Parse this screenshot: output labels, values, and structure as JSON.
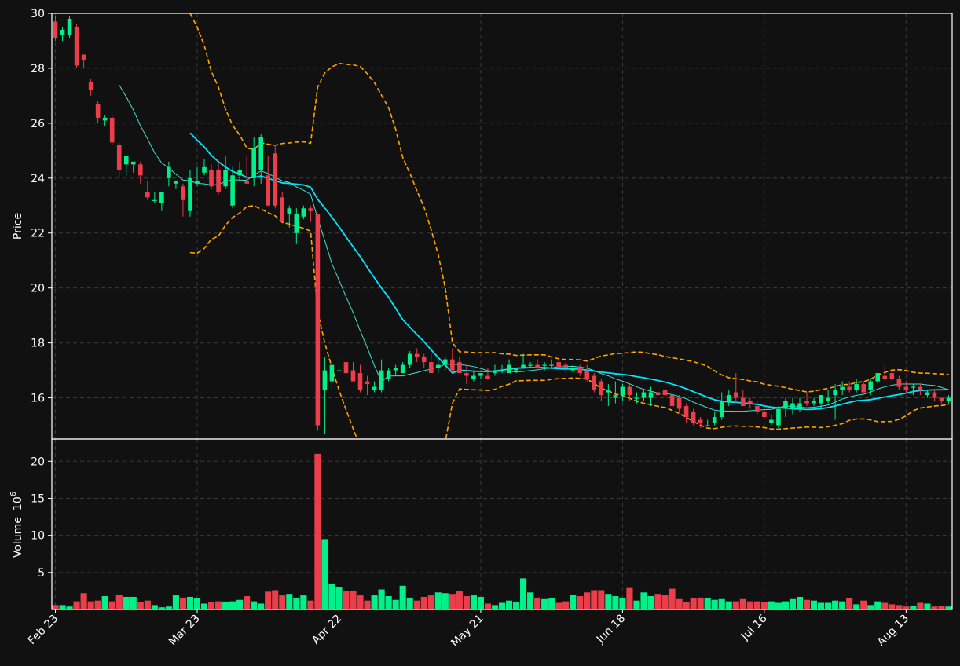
{
  "chart_data": {
    "type": "candlestick",
    "price_panel": {
      "ylabel": "Price",
      "ylim": [
        14.5,
        30
      ],
      "yticks": [
        16,
        18,
        20,
        22,
        24,
        26,
        28,
        30
      ],
      "grid": true
    },
    "volume_panel": {
      "ylabel": "Volume",
      "ylabel_exponent": "10",
      "ylabel_power": "6",
      "ylim": [
        0,
        23
      ],
      "yticks": [
        5,
        10,
        15,
        20
      ],
      "grid": true
    },
    "x_axis": {
      "n_bars": 127,
      "ticks": [
        {
          "label": "Feb 23",
          "index": 0
        },
        {
          "label": "Mar 23",
          "index": 20
        },
        {
          "label": "Apr 22",
          "index": 40
        },
        {
          "label": "May 21",
          "index": 60
        },
        {
          "label": "Jun 18",
          "index": 80
        },
        {
          "label": "Jul 16",
          "index": 100
        },
        {
          "label": "Aug 13",
          "index": 120
        }
      ]
    },
    "colors": {
      "background": "#111111",
      "up": "#00f08a",
      "down": "#ec3e4a",
      "ma_fast": "#40e0d0",
      "ma_slow": "#00e5ff",
      "bollinger": "#ffa500",
      "axis": "#ffffff",
      "grid": "#3a3a3a"
    },
    "moving_averages": [
      {
        "window": 10,
        "color": "#40e0d0",
        "line_width": 1
      },
      {
        "window": 20,
        "color": "#00e5ff",
        "line_width": 1.8
      }
    ],
    "bollinger": {
      "window": 20,
      "num_std": 2,
      "style": "dashed",
      "color": "#ffa500"
    },
    "candles": {
      "open": [
        29.7,
        29.2,
        29.2,
        29.5,
        28.5,
        27.5,
        26.7,
        26.1,
        26.2,
        25.2,
        24.5,
        24.5,
        24.5,
        23.5,
        23.2,
        23.1,
        24.0,
        23.8,
        23.7,
        22.8,
        23.8,
        24.2,
        24.3,
        24.3,
        23.7,
        23.0,
        24.1,
        23.9,
        24.0,
        24.3,
        24.1,
        24.9,
        23.3,
        22.7,
        22.0,
        22.6,
        22.9,
        22.7,
        16.3,
        16.6,
        17.0,
        17.3,
        17.0,
        16.9,
        16.6,
        16.3,
        16.3,
        16.7,
        17.0,
        16.9,
        17.2,
        17.6,
        17.5,
        17.3,
        17.1,
        17.2,
        17.4,
        17.3,
        16.9,
        16.7,
        16.8,
        16.8,
        16.9,
        17.0,
        16.9,
        17.0,
        17.1,
        17.2,
        17.2,
        17.2,
        17.2,
        17.3,
        17.2,
        17.0,
        17.1,
        17.0,
        16.8,
        16.6,
        16.2,
        16.0,
        16.1,
        16.4,
        16.0,
        16.0,
        16.0,
        16.2,
        16.3,
        16.1,
        16.0,
        15.7,
        15.5,
        15.2,
        15.0,
        15.1,
        15.3,
        15.9,
        16.2,
        16.0,
        15.9,
        15.7,
        15.5,
        15.1,
        15.0,
        15.6,
        15.6,
        15.6,
        15.9,
        15.8,
        15.8,
        15.9,
        16.1,
        16.3,
        16.4,
        16.3,
        16.5,
        16.3,
        16.6,
        16.8,
        16.9,
        16.7,
        16.4,
        16.4,
        16.4,
        16.1,
        16.2,
        16.0,
        15.9
      ],
      "high": [
        29.9,
        29.5,
        29.9,
        29.6,
        28.5,
        27.6,
        26.8,
        26.3,
        26.3,
        25.3,
        24.8,
        24.6,
        24.6,
        23.9,
        23.5,
        23.5,
        24.6,
        23.9,
        23.8,
        24.3,
        24.4,
        24.7,
        24.5,
        24.6,
        24.8,
        24.4,
        24.6,
        24.8,
        25.5,
        25.6,
        24.8,
        25.2,
        23.5,
        23.0,
        22.9,
        23.0,
        23.0,
        17.5,
        17.5,
        17.4,
        17.5,
        17.6,
        17.3,
        17.2,
        16.8,
        16.6,
        17.4,
        17.1,
        17.2,
        17.3,
        17.7,
        17.8,
        17.6,
        17.6,
        17.4,
        17.5,
        17.8,
        17.5,
        17.2,
        17.0,
        16.9,
        17.1,
        17.2,
        17.2,
        17.4,
        17.1,
        17.6,
        17.3,
        17.4,
        17.3,
        17.4,
        17.4,
        17.3,
        17.2,
        17.2,
        17.2,
        16.9,
        16.7,
        16.5,
        16.6,
        16.5,
        16.5,
        16.2,
        16.3,
        16.4,
        16.3,
        16.4,
        16.2,
        16.1,
        15.8,
        15.6,
        15.3,
        15.2,
        15.5,
        16.2,
        16.3,
        16.9,
        16.3,
        16.0,
        15.9,
        15.6,
        15.4,
        15.7,
        16.0,
        16.0,
        16.0,
        16.2,
        16.0,
        16.1,
        16.3,
        16.5,
        16.6,
        16.6,
        16.7,
        16.6,
        16.7,
        16.9,
        17.2,
        17.0,
        16.8,
        16.6,
        16.5,
        16.5,
        16.3,
        16.3,
        16.0,
        16.1
      ],
      "low": [
        29.0,
        29.0,
        29.1,
        28.0,
        28.0,
        27.0,
        26.0,
        25.9,
        25.2,
        24.0,
        24.1,
        24.2,
        23.8,
        23.2,
        23.1,
        22.8,
        23.7,
        23.6,
        22.6,
        22.6,
        23.7,
        24.1,
        23.6,
        23.4,
        23.6,
        22.9,
        23.9,
        23.8,
        23.7,
        23.8,
        23.6,
        22.9,
        22.7,
        22.2,
        21.6,
        22.5,
        22.4,
        14.8,
        14.7,
        16.3,
        16.9,
        16.8,
        16.8,
        16.2,
        16.1,
        16.2,
        16.2,
        16.6,
        16.8,
        16.9,
        17.1,
        17.3,
        17.1,
        17.0,
        16.9,
        17.0,
        17.3,
        16.9,
        16.5,
        16.6,
        16.7,
        16.7,
        16.8,
        16.9,
        16.9,
        16.9,
        17.1,
        17.1,
        17.0,
        17.0,
        17.1,
        17.1,
        16.9,
        16.9,
        16.8,
        16.6,
        16.2,
        15.9,
        15.7,
        15.8,
        15.9,
        15.9,
        15.8,
        15.9,
        15.7,
        16.1,
        16.0,
        15.8,
        15.5,
        15.1,
        15.0,
        14.9,
        15.0,
        15.0,
        15.2,
        15.7,
        15.8,
        15.7,
        15.6,
        15.4,
        15.3,
        15.0,
        14.9,
        15.3,
        15.4,
        15.5,
        15.7,
        15.7,
        15.6,
        15.8,
        15.2,
        16.1,
        16.2,
        16.2,
        16.2,
        16.1,
        16.5,
        16.6,
        16.6,
        16.3,
        16.2,
        16.1,
        16.1,
        16.0,
        15.9,
        15.8,
        15.8
      ],
      "close": [
        29.1,
        29.4,
        29.8,
        28.1,
        28.3,
        27.2,
        26.2,
        26.2,
        25.3,
        24.3,
        24.8,
        24.6,
        24.1,
        23.3,
        23.2,
        23.5,
        24.4,
        23.9,
        23.2,
        24.0,
        23.9,
        24.4,
        23.7,
        23.5,
        24.3,
        24.1,
        24.3,
        23.8,
        25.1,
        25.5,
        23.0,
        23.0,
        22.4,
        22.9,
        22.7,
        22.9,
        22.8,
        15.0,
        17.0,
        17.2,
        17.0,
        16.9,
        16.6,
        16.3,
        16.5,
        16.4,
        17.0,
        17.0,
        17.1,
        17.2,
        17.6,
        17.5,
        17.3,
        16.9,
        17.2,
        17.4,
        17.0,
        16.9,
        16.8,
        16.8,
        16.9,
        16.7,
        17.0,
        17.0,
        17.2,
        17.1,
        17.2,
        17.2,
        17.1,
        17.2,
        17.2,
        17.1,
        17.1,
        17.1,
        16.9,
        16.7,
        16.3,
        16.1,
        16.3,
        16.1,
        16.4,
        16.1,
        16.0,
        16.2,
        16.2,
        16.1,
        16.1,
        15.7,
        15.6,
        15.3,
        15.1,
        15.1,
        15.0,
        15.3,
        15.9,
        16.1,
        16.0,
        15.7,
        15.8,
        15.5,
        15.3,
        15.2,
        15.6,
        15.9,
        15.8,
        15.8,
        15.8,
        15.9,
        16.1,
        16.0,
        16.3,
        16.4,
        16.3,
        16.5,
        16.2,
        16.6,
        16.9,
        16.7,
        16.7,
        16.4,
        16.3,
        16.4,
        16.3,
        16.2,
        16.0,
        15.9,
        16.0
      ]
    },
    "volume": [
      0.6,
      0.6,
      0.4,
      1.1,
      2.2,
      1.1,
      1.2,
      1.8,
      1.1,
      2.0,
      1.7,
      1.7,
      1.0,
      1.2,
      0.6,
      0.3,
      0.4,
      1.9,
      1.6,
      1.7,
      1.5,
      0.8,
      1.0,
      1.1,
      1.0,
      1.1,
      1.3,
      1.8,
      1.1,
      0.8,
      2.4,
      2.6,
      1.9,
      2.1,
      1.5,
      1.9,
      1.2,
      21.0,
      9.5,
      3.4,
      3.0,
      2.5,
      2.5,
      1.9,
      1.2,
      1.9,
      2.7,
      1.8,
      1.3,
      3.2,
      1.6,
      1.2,
      1.7,
      1.9,
      2.3,
      2.2,
      2.1,
      2.5,
      1.8,
      1.9,
      1.7,
      0.8,
      0.6,
      0.9,
      1.2,
      1.0,
      4.2,
      2.3,
      1.6,
      1.4,
      1.5,
      0.9,
      1.1,
      2.0,
      1.8,
      2.3,
      2.6,
      2.6,
      2.1,
      1.8,
      1.6,
      2.9,
      1.2,
      2.3,
      1.8,
      2.1,
      2.0,
      2.8,
      1.4,
      1.0,
      1.5,
      1.6,
      1.5,
      1.3,
      1.4,
      1.1,
      1.1,
      1.4,
      1.1,
      1.1,
      1.0,
      1.1,
      0.9,
      1.1,
      1.4,
      1.7,
      1.3,
      1.2,
      0.9,
      0.9,
      1.2,
      1.1,
      1.5,
      0.7,
      1.2,
      0.6,
      1.1,
      0.9,
      0.7,
      0.6,
      0.4,
      0.5,
      0.9,
      0.8,
      0.4,
      0.5,
      0.4
    ]
  }
}
